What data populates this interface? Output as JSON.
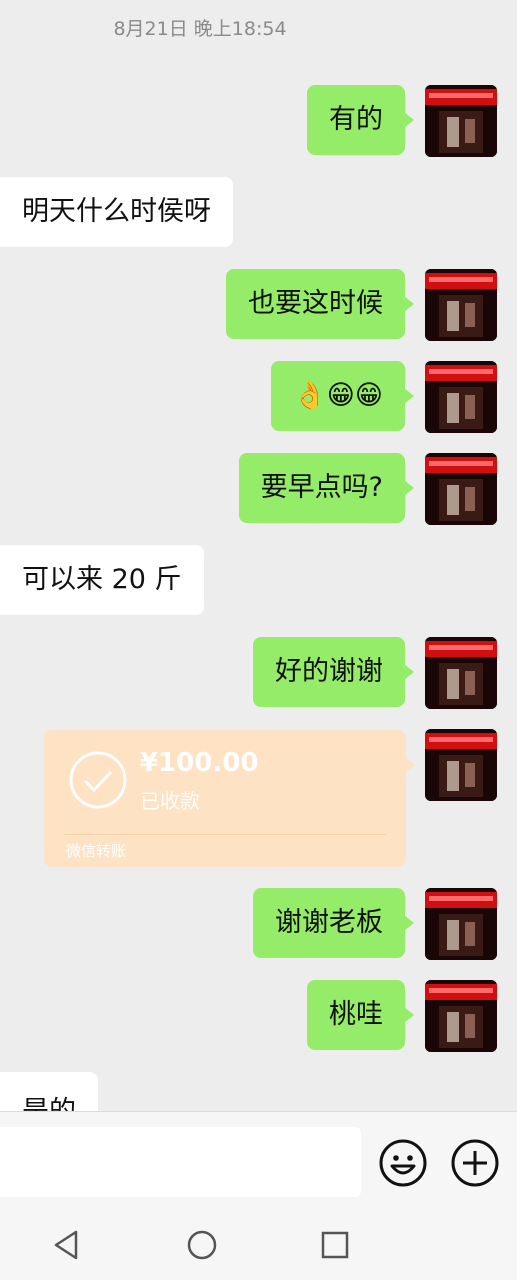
{
  "timestamp": "8月21日 晚上18:54",
  "messages": [
    {
      "dir": "out",
      "text": "有的"
    },
    {
      "dir": "in",
      "text": "明天什么时侯呀"
    },
    {
      "dir": "out",
      "text": "也要这时候"
    },
    {
      "dir": "out",
      "text": "👌😁😁"
    },
    {
      "dir": "out",
      "text": "要早点吗?"
    },
    {
      "dir": "in",
      "text": "可以来 20 斤"
    },
    {
      "dir": "out",
      "text": "好的谢谢"
    },
    {
      "dir": "out",
      "text": "谢谢老板"
    },
    {
      "dir": "out",
      "text": "桃哇"
    },
    {
      "dir": "in",
      "text": "是的"
    }
  ],
  "transfer": {
    "amount": "¥100.00",
    "status": "已收款",
    "label": "微信转账"
  },
  "input": {
    "value": ""
  },
  "icons": {
    "emoji": "emoji-icon",
    "plus": "plus-icon",
    "back": "back-triangle-icon",
    "home": "home-circle-icon",
    "recent": "recent-square-icon"
  },
  "colors": {
    "outgoing_bubble": "#95ec69",
    "incoming_bubble": "#ffffff",
    "transfer_card": "#fde2c4",
    "background": "#ededed"
  }
}
